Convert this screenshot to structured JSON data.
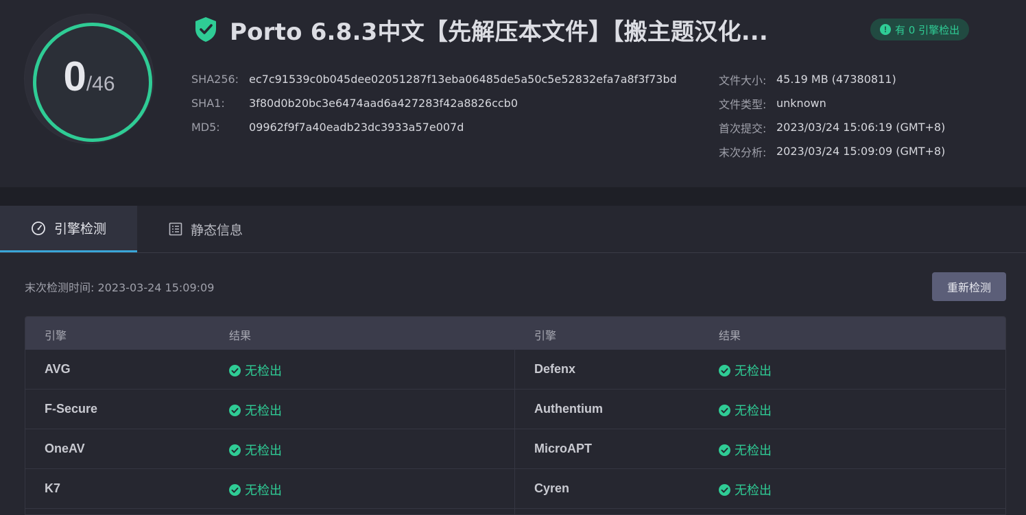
{
  "score": {
    "detected": "0",
    "total": "/46"
  },
  "title": "Porto 6.8.3中文【先解压本文件】【搬主题汉化...",
  "badge": "有 0 引擎检出",
  "hashes": [
    {
      "key": "SHA256:",
      "value": "ec7c91539c0b045dee02051287f13eba06485de5a50c5e52832efa7a8f3f73bd"
    },
    {
      "key": "SHA1:",
      "value": "3f80d0b20bc3e6474aad6a427283f42a8826ccb0"
    },
    {
      "key": "MD5:",
      "value": "09962f9f7a40eadb23dc3933a57e007d"
    }
  ],
  "meta": [
    {
      "key": "文件大小:",
      "value": "45.19 MB (47380811)"
    },
    {
      "key": "文件类型:",
      "value": "unknown"
    },
    {
      "key": "首次提交:",
      "value": "2023/03/24 15:06:19 (GMT+8)"
    },
    {
      "key": "末次分析:",
      "value": "2023/03/24 15:09:09 (GMT+8)"
    }
  ],
  "tabs": [
    {
      "label": "引擎检测",
      "icon": "gauge-icon",
      "active": true
    },
    {
      "label": "静态信息",
      "icon": "document-icon",
      "active": false
    }
  ],
  "scan_time": "末次检测时间: 2023-03-24 15:09:09",
  "rescan_label": "重新检测",
  "table": {
    "headers": [
      "引擎",
      "结果",
      "引擎",
      "结果"
    ],
    "rows": [
      {
        "left_engine": "AVG",
        "left_result": "无检出",
        "right_engine": "Defenx",
        "right_result": "无检出"
      },
      {
        "left_engine": "F-Secure",
        "left_result": "无检出",
        "right_engine": "Authentium",
        "right_result": "无检出"
      },
      {
        "left_engine": "OneAV",
        "left_result": "无检出",
        "right_engine": "MicroAPT",
        "right_result": "无检出"
      },
      {
        "left_engine": "K7",
        "left_result": "无检出",
        "right_engine": "Cyren",
        "right_result": "无检出"
      }
    ]
  },
  "colors": {
    "accent": "#2fcc95",
    "tab_underline": "#3aa6d8",
    "button": "#5b5e78"
  }
}
